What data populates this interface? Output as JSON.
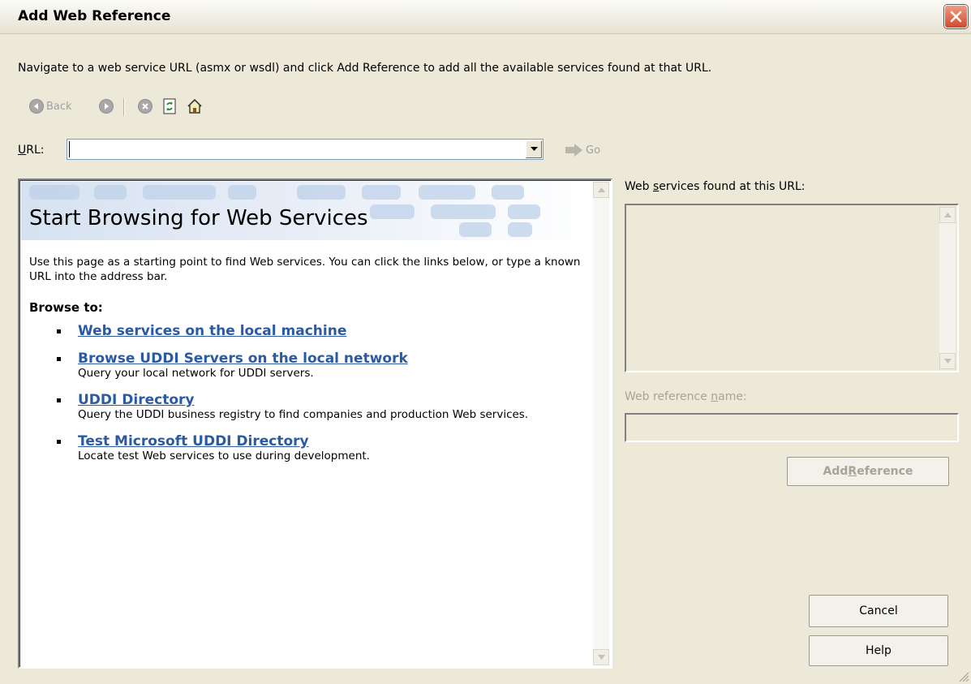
{
  "window": {
    "title": "Add Web Reference"
  },
  "instructions": "Navigate to a web service URL (asmx or wsdl) and click Add Reference to add all the available services found at that URL.",
  "toolbar": {
    "back_label": "Back",
    "icons": [
      "back-icon",
      "forward-icon",
      "stop-icon",
      "refresh-icon",
      "home-icon"
    ]
  },
  "url_bar": {
    "label": "URL:",
    "value": "",
    "go_label": "Go"
  },
  "browser": {
    "banner_title": "Start Browsing for Web Services",
    "intro": "Use this page as a starting point to find Web services. You can click the links below, or type a known URL into the address bar.",
    "browse_heading": "Browse to:",
    "links": [
      {
        "label": "Web services on the local machine",
        "desc": ""
      },
      {
        "label": "Browse UDDI Servers on the local network",
        "desc": "Query your local network for UDDI servers."
      },
      {
        "label": "UDDI Directory",
        "desc": "Query the UDDI business registry to find companies and production Web services."
      },
      {
        "label": "Test Microsoft UDDI Directory",
        "desc": "Locate test Web services to use during development."
      }
    ]
  },
  "right_panel": {
    "services_label": "Web services found at this URL:",
    "reference_name_label": "Web reference name:",
    "reference_name_value": "",
    "add_reference_label": "Add Reference"
  },
  "buttons": {
    "cancel_label": "Cancel",
    "help_label": "Help"
  },
  "colors": {
    "dialog_bg": "#ece9d8",
    "link": "#2b5aa5",
    "disabled_text": "#a6a498"
  }
}
